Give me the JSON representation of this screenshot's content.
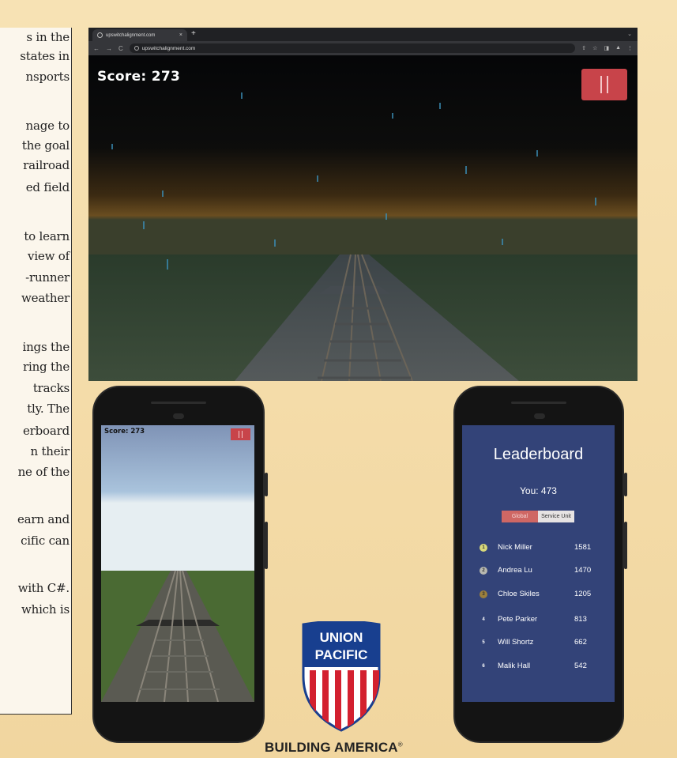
{
  "text_fragments": [
    "s in the",
    "states in",
    "nsports",
    "nage to",
    "the goal",
    "railroad",
    "ed field",
    "to learn",
    "view of",
    "-runner",
    "weather",
    "ings the",
    "ring the",
    "tracks",
    "tly. The",
    "erboard",
    "n their",
    "ne of the",
    "earn and",
    "cific can",
    "with C#.",
    "which is"
  ],
  "browser": {
    "tab_title": "upswitchalignment.com",
    "tab_close": "×",
    "new_tab": "+",
    "url": "upswitchalignment.com",
    "nav_back": "←",
    "nav_forward": "→",
    "nav_reload": "C",
    "tools": [
      "⇧",
      "☆",
      "◨",
      "▲",
      "⋮"
    ],
    "chevron": "⌄"
  },
  "game_desktop": {
    "score": "Score: 273"
  },
  "game_mobile": {
    "score": "Score: 273"
  },
  "leaderboard": {
    "title": "Leaderboard",
    "you": "You: 473",
    "tabs": [
      "Global",
      "Service Unit"
    ],
    "rows": [
      {
        "rank": "1",
        "name": "Nick Miller",
        "points": "1581",
        "medal": "#d8d87a"
      },
      {
        "rank": "2",
        "name": "Andrea Lu",
        "points": "1470",
        "medal": "#b8b8b0"
      },
      {
        "rank": "3",
        "name": "Chloe Skiles",
        "points": "1205",
        "medal": "#9c7f3c"
      },
      {
        "rank": "4",
        "name": "Pete Parker",
        "points": "813",
        "medal": ""
      },
      {
        "rank": "5",
        "name": "Will Shortz",
        "points": "662",
        "medal": ""
      },
      {
        "rank": "6",
        "name": "Malik Hall",
        "points": "542",
        "medal": ""
      }
    ]
  },
  "logo": {
    "line1": "UNION",
    "line2": "PACIFIC",
    "tagline": "BUILDING AMERICA",
    "registered": "®"
  },
  "colors": {
    "pause_red": "#c8444a",
    "leaderboard_bg": "#334378",
    "shield_blue": "#183f8f",
    "shield_red": "#d3202f"
  }
}
